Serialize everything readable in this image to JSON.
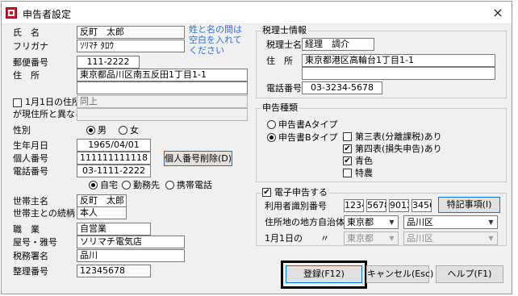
{
  "window": {
    "title": "申告者設定",
    "close_label": "×"
  },
  "personal": {
    "name_label": "氏　名",
    "name_value": "反町　太郎",
    "furigana_label": "フリガナ",
    "furigana_value": "ｿﾘﾏﾁ ﾀﾛｳ",
    "name_hint_1": "姓と名の間は",
    "name_hint_2": "空白を入れて",
    "name_hint_3": "ください",
    "postal_label": "郵便番号",
    "postal_value": "111-2222",
    "address_label": "住　所",
    "address_value_1": "東京都品川区南五反田1丁目1-1",
    "address_value_2": "",
    "jan1_label_1": "1月1日の住所",
    "jan1_label_2": "が現住所と異なる",
    "jan1_value_1": "同上",
    "jan1_value_2": "",
    "sex_label": "性別",
    "sex_male": "男",
    "sex_female": "女",
    "birth_label": "生年月日",
    "birth_value": "1965/04/01",
    "mynumber_label": "個人番号",
    "mynumber_value": "111111111118",
    "mynumber_delete_button": "個人番号削除(D)",
    "phone_label": "電話番号",
    "phone_value": "03-1111-2222",
    "phone_home": "自宅",
    "phone_work": "勤務先",
    "phone_mobile": "携帯電話",
    "householder_label": "世帯主名",
    "householder_value": "反町　太郎",
    "relation_label": "世帯主との続柄",
    "relation_value": "本人",
    "occupation_label": "職　業",
    "occupation_value": "自営業",
    "trade_name_label": "屋号・雅号",
    "trade_name_value": "ソリマチ電気店",
    "tax_office_label": "税務署名",
    "tax_office_value": "品川",
    "ref_number_label": "整理番号",
    "ref_number_value": "12345678"
  },
  "accountant": {
    "group_title": "税理士情報",
    "name_label": "税理士名",
    "name_value": "経理　調介",
    "address_label": "住　所",
    "address_value_1": "東京都港区高輪台1丁目1-1",
    "address_value_2": "",
    "phone_label": "電話番号",
    "phone_value": "03-3234-5678"
  },
  "filing_type": {
    "group_title": "申告種類",
    "type_a": "申告書Aタイプ",
    "type_b": "申告書Bタイプ",
    "table3": "第三表(分離課税)あり",
    "table4": "第四表(損失申告)あり",
    "blue": "青色",
    "special": "特農"
  },
  "etax": {
    "group_title": "電子申告する",
    "user_id_label": "利用者識別番号",
    "user_id_parts": [
      "1234",
      "5678",
      "9012",
      "3456"
    ],
    "special_button": "特記事項(I)",
    "local_gov_label": "住所地の地方自治体",
    "pref_value": "東京都",
    "city_value": "品川区",
    "jan1_label": "1月1日の　　〃",
    "jan1_pref_value": "東京都",
    "jan1_city_value": "品川区"
  },
  "buttons": {
    "register": "登録(F12)",
    "cancel": "キャンセル(Esc)",
    "help": "ヘルプ(F1)"
  },
  "state": {
    "sex": "male",
    "filing_type": "B",
    "phone_type": "home",
    "table4_checked": true,
    "blue_checked": true,
    "etax_checked": true
  }
}
